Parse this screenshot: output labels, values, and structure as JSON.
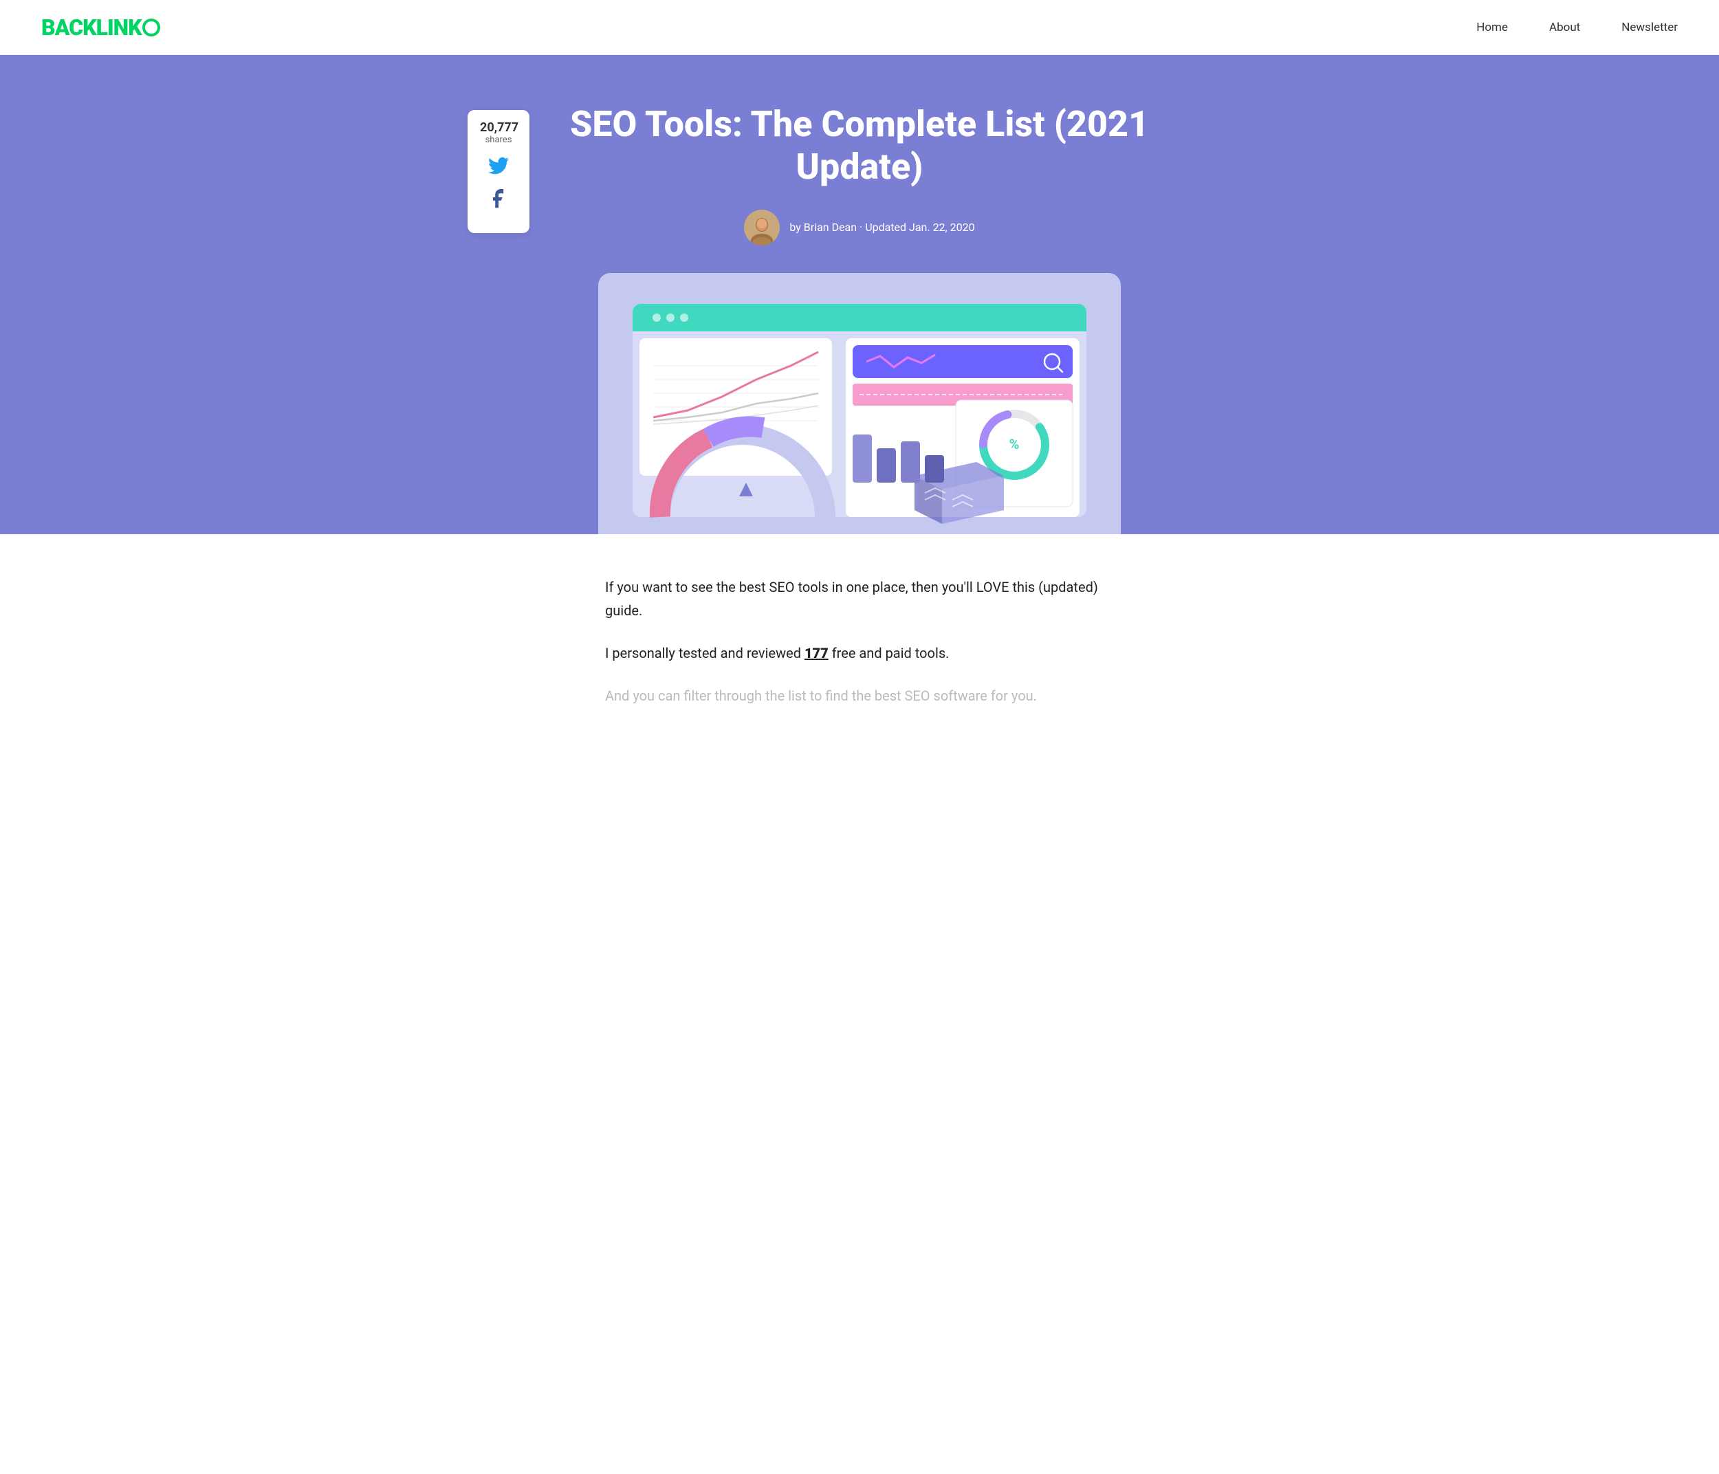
{
  "nav": {
    "logo_text": "BACKLINK",
    "links": [
      {
        "label": "Home",
        "href": "#"
      },
      {
        "label": "About",
        "href": "#"
      },
      {
        "label": "Newsletter",
        "href": "#"
      }
    ]
  },
  "share": {
    "count": "20,777",
    "label": "shares"
  },
  "hero": {
    "title": "SEO Tools: The Complete List (2021 Update)",
    "author_name": "Brian Dean",
    "updated_date": "Updated Jan. 22, 2020",
    "byline": "by Brian Dean · Updated Jan. 22, 2020"
  },
  "content": {
    "intro_1": "If you want to see the best SEO tools in one place, then you'll LOVE this (updated) guide.",
    "intro_2_prefix": "I personally tested and reviewed ",
    "intro_2_bold": "177",
    "intro_2_suffix": " free and paid tools.",
    "intro_3": "And you can filter through the list to find the best SEO software for you."
  }
}
